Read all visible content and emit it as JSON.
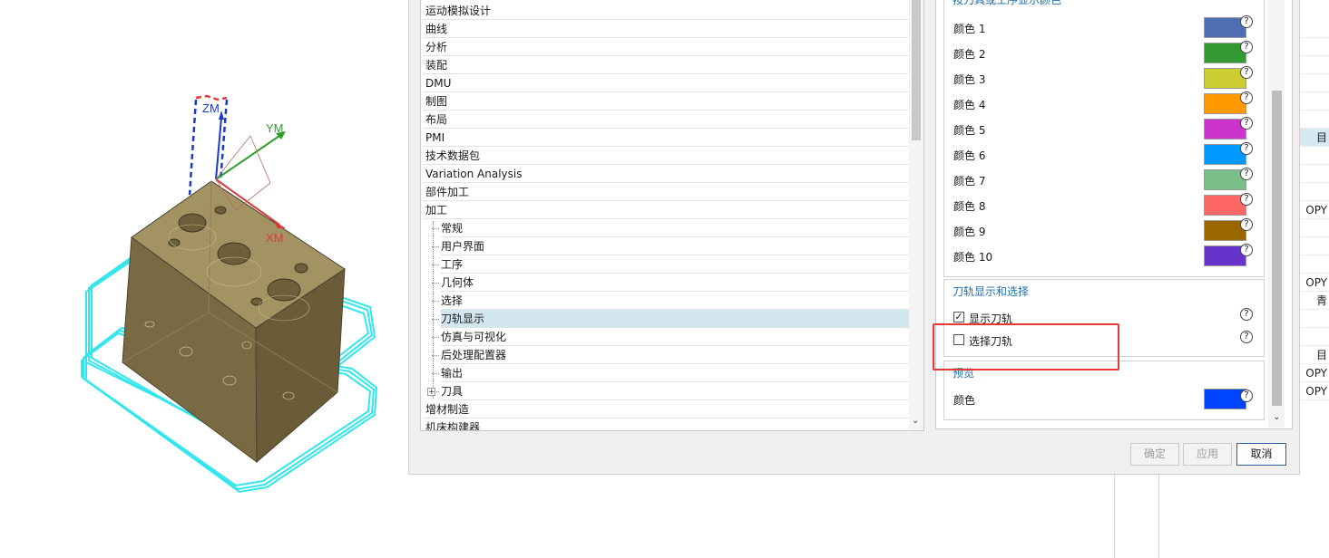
{
  "viewport": {
    "axes": {
      "z": "ZM",
      "y": "YM",
      "x": "XM"
    }
  },
  "tree": {
    "items": [
      {
        "label": "运动模拟设计",
        "level": 0
      },
      {
        "label": "曲线",
        "level": 0
      },
      {
        "label": "分析",
        "level": 0
      },
      {
        "label": "装配",
        "level": 0
      },
      {
        "label": "DMU",
        "level": 0
      },
      {
        "label": "制图",
        "level": 0
      },
      {
        "label": "布局",
        "level": 0
      },
      {
        "label": "PMI",
        "level": 0
      },
      {
        "label": "技术数据包",
        "level": 0
      },
      {
        "label": "Variation Analysis",
        "level": 0
      },
      {
        "label": "部件加工",
        "level": 0
      },
      {
        "label": "加工",
        "level": 0
      },
      {
        "label": "常规",
        "level": 1
      },
      {
        "label": "用户界面",
        "level": 1
      },
      {
        "label": "工序",
        "level": 1
      },
      {
        "label": "几何体",
        "level": 1
      },
      {
        "label": "选择",
        "level": 1
      },
      {
        "label": "刀轨显示",
        "level": 1,
        "selected": true
      },
      {
        "label": "仿真与可视化",
        "level": 1
      },
      {
        "label": "后处理配置器",
        "level": 1
      },
      {
        "label": "输出",
        "level": 1
      },
      {
        "label": "刀具",
        "level": 1,
        "expander": "+"
      },
      {
        "label": "增材制造",
        "level": 0
      },
      {
        "label": "机床构建器",
        "level": 0
      }
    ]
  },
  "settings": {
    "color_group_title": "按刀具或工序显示颜色",
    "colors": [
      {
        "label": "颜色 1",
        "hex": "#4f6db2"
      },
      {
        "label": "颜色 2",
        "hex": "#339933"
      },
      {
        "label": "颜色 3",
        "hex": "#cccc33"
      },
      {
        "label": "颜色 4",
        "hex": "#ff9900"
      },
      {
        "label": "颜色 5",
        "hex": "#cc33cc"
      },
      {
        "label": "颜色 6",
        "hex": "#0099ff"
      },
      {
        "label": "颜色 7",
        "hex": "#7abf8a"
      },
      {
        "label": "颜色 8",
        "hex": "#ff6666"
      },
      {
        "label": "颜色 9",
        "hex": "#996600"
      },
      {
        "label": "颜色 10",
        "hex": "#6633cc"
      }
    ],
    "toolpath_group": {
      "title": "刀轨显示和选择",
      "show_toolpath": {
        "label": "显示刀轨",
        "checked": true
      },
      "select_toolpath": {
        "label": "选择刀轨",
        "checked": false
      }
    },
    "preview_group": {
      "title": "预览",
      "color_label": "颜色",
      "color_hex": "#0044ff"
    },
    "help_glyph": "?"
  },
  "buttons": {
    "ok": "确定",
    "apply": "应用",
    "cancel": "取消"
  },
  "background_panel": {
    "rows": [
      {
        "text": "",
        "selected": false
      },
      {
        "text": "",
        "selected": false
      },
      {
        "text": "",
        "selected": false
      },
      {
        "text": "",
        "selected": false
      },
      {
        "text": "",
        "selected": false
      },
      {
        "text": "",
        "selected": false
      },
      {
        "text": "目",
        "selected": true
      },
      {
        "text": "",
        "selected": false
      },
      {
        "text": "",
        "selected": false
      },
      {
        "text": "",
        "selected": false
      },
      {
        "text": "OPY",
        "selected": false
      },
      {
        "text": "",
        "selected": false
      },
      {
        "text": "",
        "selected": false
      },
      {
        "text": "",
        "selected": false
      },
      {
        "text": "OPY",
        "selected": false
      },
      {
        "text": "青",
        "selected": false
      },
      {
        "text": "",
        "selected": false
      },
      {
        "text": "",
        "selected": false
      },
      {
        "text": "目",
        "selected": false
      },
      {
        "text": "OPY",
        "selected": false
      },
      {
        "text": "OPY",
        "selected": false
      }
    ]
  }
}
